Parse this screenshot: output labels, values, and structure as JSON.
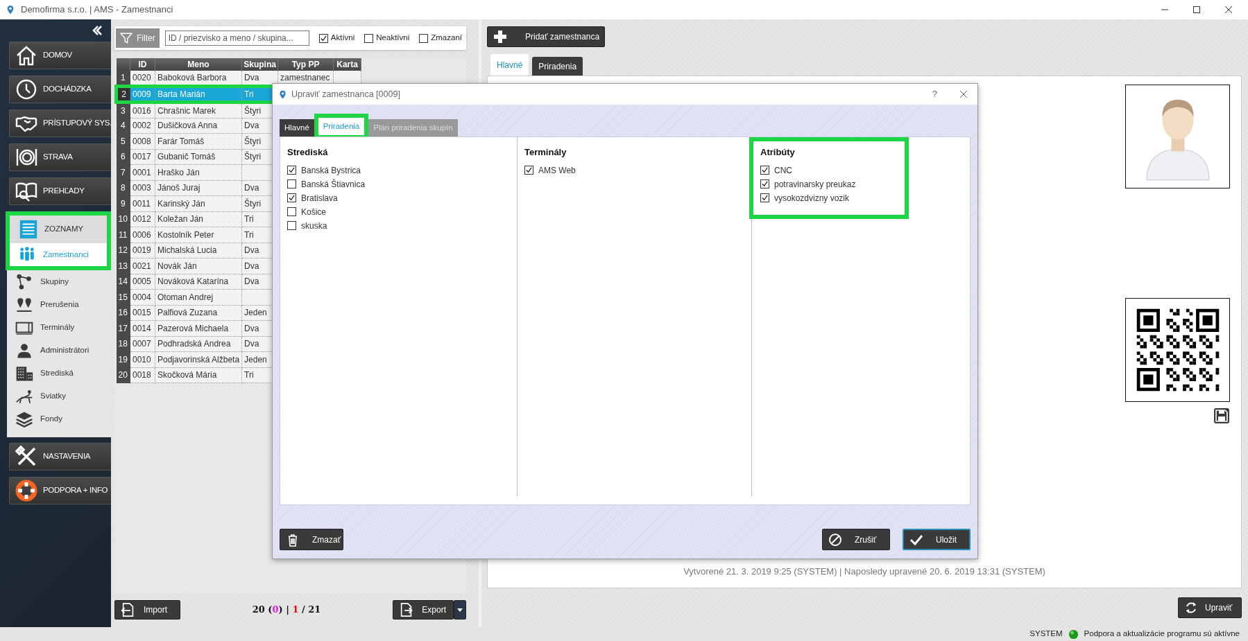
{
  "window": {
    "title": "Demofirma s.r.o. | AMS - Zamestnanci"
  },
  "sidebar": {
    "main_items": [
      {
        "label": "DOMOV"
      },
      {
        "label": "DOCHÁDZKA"
      },
      {
        "label": "PRÍSTUPOVÝ SYS."
      },
      {
        "label": "STRAVA"
      },
      {
        "label": "PREHĽADY"
      }
    ],
    "section": {
      "label": "ZOZNAMY",
      "highlighted": true,
      "items": [
        {
          "label": "Zamestnanci",
          "selected": true
        },
        {
          "label": "Skupiny",
          "selected": false
        },
        {
          "label": "Prerušenia",
          "selected": false
        },
        {
          "label": "Terminály",
          "selected": false
        },
        {
          "label": "Administrátori",
          "selected": false
        },
        {
          "label": "Strediská",
          "selected": false
        },
        {
          "label": "Sviatky",
          "selected": false
        },
        {
          "label": "Fondy",
          "selected": false
        }
      ]
    },
    "bottom_items": [
      {
        "label": "NASTAVENIA"
      },
      {
        "label": "PODPORA + INFO"
      }
    ]
  },
  "filter": {
    "button": "Filter",
    "placeholder": "ID / priezvisko a meno / skupina...",
    "checkboxes": [
      {
        "label": "Aktívni",
        "checked": true
      },
      {
        "label": "Neaktívni",
        "checked": false
      },
      {
        "label": "Zmazaní",
        "checked": false
      }
    ]
  },
  "table": {
    "columns": [
      "ID",
      "Meno",
      "Skupina",
      "Typ PP",
      "Karta"
    ],
    "rows": [
      {
        "number": "1",
        "id": "0020",
        "name": "Baboková Barbora",
        "group": "Dva",
        "type": "zamestnanec",
        "selected": false,
        "highlighted": false
      },
      {
        "number": "2",
        "id": "0009",
        "name": "Barta Marián",
        "group": "Tri",
        "selected": true,
        "highlighted": true
      },
      {
        "number": "3",
        "id": "0016",
        "name": "Chrašnic Marek",
        "group": "Štyri",
        "selected": false,
        "highlighted": false
      },
      {
        "number": "4",
        "id": "0002",
        "name": "Dušičková Anna",
        "group": "Dva",
        "selected": false,
        "highlighted": false
      },
      {
        "number": "5",
        "id": "0008",
        "name": "Farár Tomáš",
        "group": "Štyri",
        "selected": false,
        "highlighted": false
      },
      {
        "number": "6",
        "id": "0017",
        "name": "Gubanič Tomáš",
        "group": "Štyri",
        "selected": false,
        "highlighted": false
      },
      {
        "number": "7",
        "id": "0001",
        "name": "Hraško Ján",
        "selected": false,
        "highlighted": false
      },
      {
        "number": "8",
        "id": "0003",
        "name": "Jánoš Juraj",
        "group": "Dva",
        "selected": false,
        "highlighted": false
      },
      {
        "number": "9",
        "id": "0011",
        "name": "Karinský Ján",
        "group": "Štyri",
        "selected": false,
        "highlighted": false
      },
      {
        "number": "10",
        "id": "0012",
        "name": "Koležan Ján",
        "group": "Tri",
        "selected": false,
        "highlighted": false
      },
      {
        "number": "11",
        "id": "0006",
        "name": "Kostolník Peter",
        "group": "Tri",
        "selected": false,
        "highlighted": false
      },
      {
        "number": "12",
        "id": "0019",
        "name": "Michalská Lucia",
        "group": "Dva",
        "selected": false,
        "highlighted": false
      },
      {
        "number": "13",
        "id": "0021",
        "name": "Novák Ján",
        "group": "Dva",
        "selected": false,
        "highlighted": false
      },
      {
        "number": "14",
        "id": "0005",
        "name": "Nováková Katarína",
        "group": "Dva",
        "selected": false,
        "highlighted": false
      },
      {
        "number": "15",
        "id": "0004",
        "name": "Otoman Andrej",
        "selected": false,
        "highlighted": false
      },
      {
        "number": "16",
        "id": "0015",
        "name": "Palfiová Zuzana",
        "group": "Jeden",
        "selected": false,
        "highlighted": false
      },
      {
        "number": "17",
        "id": "0014",
        "name": "Pazerová Michaela",
        "group": "Dva",
        "selected": false,
        "highlighted": false
      },
      {
        "number": "18",
        "id": "0007",
        "name": "Podhradská Andrea",
        "group": "Dva",
        "selected": false,
        "highlighted": false
      },
      {
        "number": "19",
        "id": "0010",
        "name": "Podjavorinská Alžbeta",
        "group": "Jeden",
        "selected": false,
        "highlighted": false
      },
      {
        "number": "20",
        "id": "0018",
        "name": "Skočková Mária",
        "group": "Tri",
        "selected": false,
        "highlighted": false
      }
    ]
  },
  "list_footer": {
    "import_button": "Import",
    "count": [
      {
        "text": "20 (",
        "kind": "plain"
      },
      {
        "text": "0",
        "kind": "deleted"
      },
      {
        "text": ") | ",
        "kind": "plain"
      },
      {
        "text": "1",
        "kind": "current"
      },
      {
        "text": " / 21",
        "kind": "plain"
      }
    ],
    "export_button": "Export"
  },
  "right_panel": {
    "add_button": "Pridať zamestnanca",
    "tabs": [
      {
        "label": "Hlavné",
        "selected": true
      },
      {
        "label": "Priradenia",
        "selected": false
      }
    ],
    "footer_text": "Vytvorené 21. 3. 2019 9:25 (SYSTEM) | Naposledy upravené 20. 6. 2019 13:31 (SYSTEM)",
    "edit_button": "Upraviť"
  },
  "status_bar": {
    "user": "SYSTEM",
    "message": "Podpora a aktualizácie programu sú aktívne"
  },
  "dialog": {
    "title": "Upraviť zamestnanca [0009]",
    "help": "?",
    "tabs": [
      {
        "label": "Hlavné",
        "selected": false,
        "disabled": false,
        "highlighted": false
      },
      {
        "label": "Priradenia",
        "selected": true,
        "disabled": false,
        "highlighted": true
      },
      {
        "label": "Plán priradenia skupín",
        "selected": false,
        "disabled": true,
        "highlighted": false
      }
    ],
    "sections": [
      {
        "title": "Strediská",
        "highlighted": false,
        "items": [
          {
            "label": "Banská Bystrica",
            "checked": true
          },
          {
            "label": "Banská Štiavnica",
            "checked": false
          },
          {
            "label": "Bratislava",
            "checked": true
          },
          {
            "label": "Košice",
            "checked": false
          },
          {
            "label": "skuska",
            "checked": false
          }
        ]
      },
      {
        "title": "Terminály",
        "highlighted": false,
        "items": [
          {
            "label": "AMS Web",
            "checked": true
          }
        ]
      },
      {
        "title": "Atribúty",
        "highlighted": true,
        "items": [
          {
            "label": "CNC",
            "checked": true
          },
          {
            "label": "potravinarsky preukaz",
            "checked": true
          },
          {
            "label": "vysokozdvizny vozik",
            "checked": true
          }
        ]
      }
    ],
    "delete_button": "Zmazať",
    "cancel_button": "Zrušiť",
    "save_button": "Uložit"
  }
}
